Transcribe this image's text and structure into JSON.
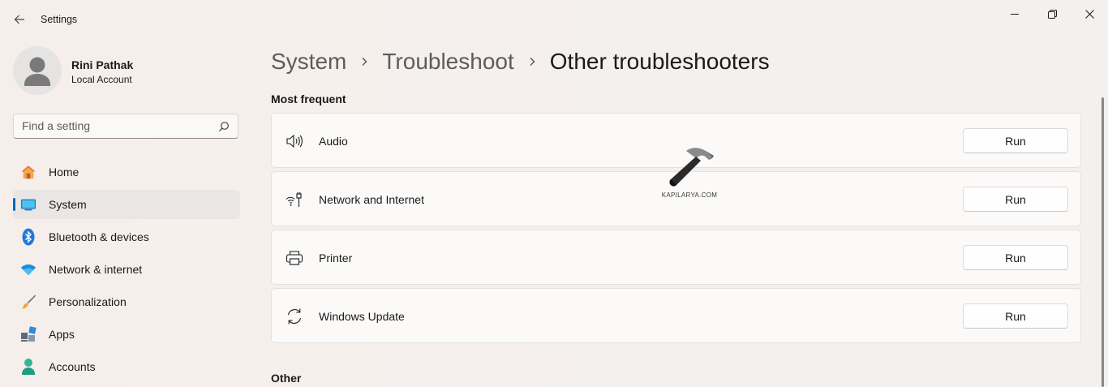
{
  "window": {
    "title": "Settings",
    "controls": {
      "minimize": "minimize-icon",
      "maximize": "restore-icon",
      "close": "close-icon"
    }
  },
  "sidebar": {
    "user": {
      "name": "Rini Pathak",
      "account_type": "Local Account"
    },
    "search": {
      "placeholder": "Find a setting",
      "value": ""
    },
    "items": [
      {
        "label": "Home",
        "icon": "home-icon",
        "active": false
      },
      {
        "label": "System",
        "icon": "system-icon",
        "active": true
      },
      {
        "label": "Bluetooth & devices",
        "icon": "bluetooth-icon",
        "active": false
      },
      {
        "label": "Network & internet",
        "icon": "wifi-icon",
        "active": false
      },
      {
        "label": "Personalization",
        "icon": "brush-icon",
        "active": false
      },
      {
        "label": "Apps",
        "icon": "apps-icon",
        "active": false
      },
      {
        "label": "Accounts",
        "icon": "accounts-icon",
        "active": false
      }
    ]
  },
  "breadcrumb": {
    "items": [
      "System",
      "Troubleshoot",
      "Other troubleshooters"
    ]
  },
  "sections": {
    "most_frequent": {
      "title": "Most frequent",
      "items": [
        {
          "label": "Audio",
          "icon": "speaker-icon",
          "button": "Run"
        },
        {
          "label": "Network and Internet",
          "icon": "network-icon",
          "button": "Run"
        },
        {
          "label": "Printer",
          "icon": "printer-icon",
          "button": "Run"
        },
        {
          "label": "Windows Update",
          "icon": "sync-icon",
          "button": "Run"
        }
      ]
    },
    "other": {
      "title": "Other"
    }
  },
  "watermark": {
    "text": "KAPILARYA.COM"
  },
  "colors": {
    "accent": "#0067c0",
    "background": "#f5f0ed",
    "card": "#fbfaf9"
  }
}
